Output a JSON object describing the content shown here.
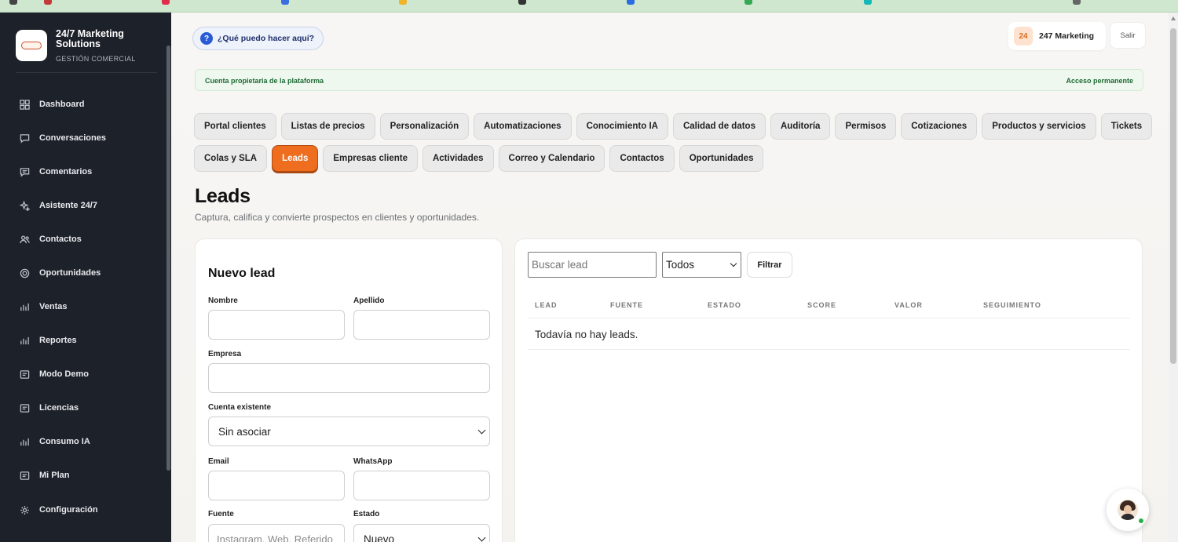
{
  "brand": {
    "name": "24/7 Marketing Solutions",
    "subtitle": "GESTIÓN COMERCIAL"
  },
  "sidebar": {
    "items": [
      {
        "label": "Dashboard",
        "icon": "grid-icon"
      },
      {
        "label": "Conversaciones",
        "icon": "chat-icon"
      },
      {
        "label": "Comentarios",
        "icon": "comment-icon"
      },
      {
        "label": "Asistente 24/7",
        "icon": "sparkle-icon"
      },
      {
        "label": "Contactos",
        "icon": "users-icon"
      },
      {
        "label": "Oportunidades",
        "icon": "target-icon"
      },
      {
        "label": "Ventas",
        "icon": "bars-icon"
      },
      {
        "label": "Reportes",
        "icon": "bars-icon"
      },
      {
        "label": "Modo Demo",
        "icon": "doc-icon"
      },
      {
        "label": "Licencias",
        "icon": "doc-icon"
      },
      {
        "label": "Consumo IA",
        "icon": "bars-icon"
      },
      {
        "label": "Mi Plan",
        "icon": "doc-icon"
      },
      {
        "label": "Configuración",
        "icon": "gear-icon"
      }
    ]
  },
  "header": {
    "help_label": "¿Qué puedo hacer aquí?",
    "account_badge": "24",
    "account_name": "247 Marketing",
    "logout_label": "Salir"
  },
  "notice": {
    "left": "Cuenta propietaria de la plataforma",
    "right": "Acceso permanente"
  },
  "tabs_row1": [
    "Portal clientes",
    "Listas de precios",
    "Personalización",
    "Automatizaciones",
    "Conocimiento IA",
    "Calidad de datos",
    "Auditoría",
    "Permisos",
    "Cotizaciones",
    "Productos y servicios",
    "Tickets"
  ],
  "tabs_row2": [
    "Colas y SLA",
    "Leads",
    "Empresas cliente",
    "Actividades",
    "Correo y Calendario",
    "Contactos",
    "Oportunidades"
  ],
  "active_tab": "Leads",
  "page": {
    "title": "Leads",
    "subtitle": "Captura, califica y convierte prospectos en clientes y oportunidades."
  },
  "form": {
    "title": "Nuevo lead",
    "nombre_label": "Nombre",
    "apellido_label": "Apellido",
    "empresa_label": "Empresa",
    "cuenta_label": "Cuenta existente",
    "cuenta_value": "Sin asociar",
    "email_label": "Email",
    "whatsapp_label": "WhatsApp",
    "fuente_label": "Fuente",
    "fuente_placeholder": "Instagram, Web, Referido",
    "estado_label": "Estado",
    "estado_value": "Nuevo"
  },
  "list": {
    "search_placeholder": "Buscar lead",
    "filter_value": "Todos",
    "filter_button": "Filtrar",
    "columns": [
      "LEAD",
      "FUENTE",
      "ESTADO",
      "SCORE",
      "VALOR",
      "SEGUIMIENTO"
    ],
    "empty_text": "Todavía no hay leads."
  },
  "colors": {
    "accent": "#ee6d1f",
    "sidebar_bg": "#1d2129",
    "help_blue": "#2a5bd7",
    "notice_green": "#1d6a33"
  }
}
